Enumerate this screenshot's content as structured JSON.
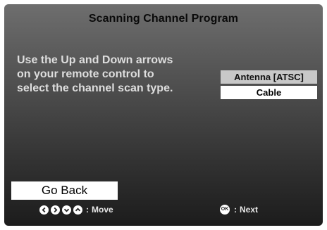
{
  "screen": {
    "title": "Scanning Channel Program"
  },
  "instructions": {
    "line1": "Use the Up and Down arrows",
    "line2": "on your remote control to",
    "line3": "select the channel scan type."
  },
  "scan_options": [
    {
      "label": "Antenna [ATSC]",
      "selected": false
    },
    {
      "label": "Cable",
      "selected": true
    }
  ],
  "buttons": {
    "go_back": "Go Back"
  },
  "legend": {
    "move_label": "Move",
    "next_label": "Next",
    "ok_key": "OK",
    "separator": ":"
  },
  "icons": {
    "left": "arrow-left-icon",
    "right": "arrow-right-icon",
    "down": "arrow-down-icon",
    "up": "arrow-up-icon",
    "ok": "ok-button-icon"
  },
  "colors": {
    "selected_bg": "#ffffff",
    "unselected_bg": "#c8c8c8",
    "instruction_text": "#dedede"
  }
}
